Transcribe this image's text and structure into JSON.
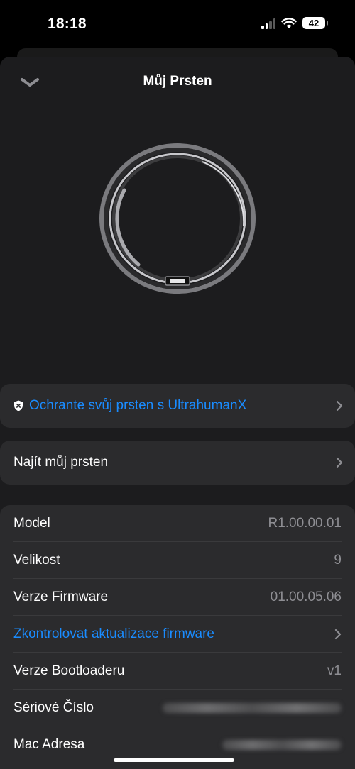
{
  "status_bar": {
    "time": "18:18",
    "battery": "42"
  },
  "nav": {
    "title": "Můj Prsten"
  },
  "actions": {
    "protect_label": "Ochrante svůj prsten s UltrahumanX",
    "find_label": "Najít můj prsten"
  },
  "info": {
    "model_label": "Model",
    "model_value": "R1.00.00.01",
    "size_label": "Velikost",
    "size_value": "9",
    "firmware_label": "Verze Firmware",
    "firmware_value": "01.00.05.06",
    "check_update_label": "Zkontrolovat aktualizace firmware",
    "bootloader_label": "Verze Bootloaderu",
    "bootloader_value": "v1",
    "serial_label": "Sériové Číslo",
    "mac_label": "Mac Adresa"
  },
  "colors": {
    "link": "#1a8cff",
    "sheet": "#1c1c1e",
    "card": "#2b2b2d",
    "secondary_text": "#8e8e93"
  },
  "icons": {
    "nav_back": "chevron-down-icon",
    "protect": "shield-icon",
    "row_disclosure": "chevron-right-icon"
  }
}
